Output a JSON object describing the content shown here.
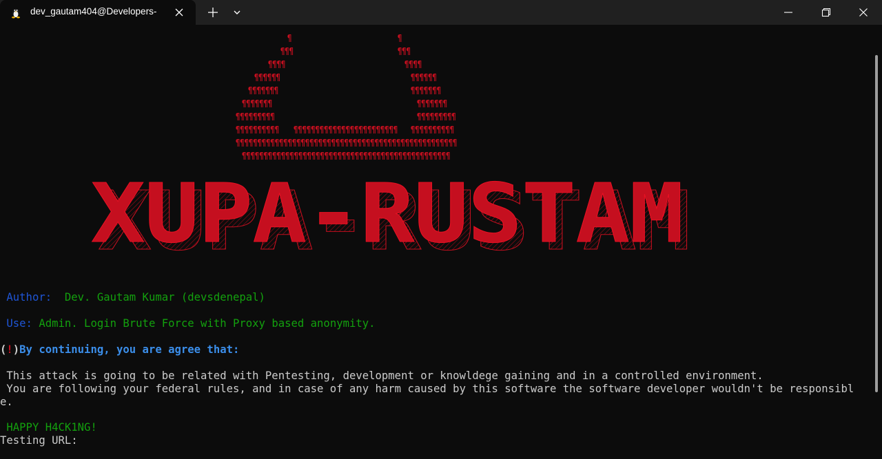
{
  "window": {
    "tab_title": "dev_gautam404@Developers-",
    "icons": {
      "tab": "linux-tux-icon",
      "close_tab": "close-icon",
      "new_tab": "plus-icon",
      "dropdown": "chevron-down-icon",
      "minimize": "minimize-icon",
      "maximize": "restore-icon",
      "close_window": "close-icon"
    }
  },
  "banner": {
    "glyph": "¶",
    "logo_text": "XUPA-RUSTAM",
    "color": "#c50f1f"
  },
  "terminal": {
    "author_label": "Author:",
    "author_value": "Dev. Gautam Kumar (devsdenepal)",
    "use_label": "Use:",
    "use_value": "Admin. Login Brute Force with Proxy based anonymity.",
    "warn_open": "(",
    "warn_mark": "!",
    "warn_close": ")",
    "warn_text": "By continuing, you are agree that:",
    "terms_line1": " This attack is going to be related with Pentesting, development or knowldege gaining and in a controlled environment.",
    "terms_line2": " You are following your federal rules, and in case of any harm caused by this software the software developer wouldn't be responsibl",
    "terms_line3": "e.",
    "happy": " HAPPY H4CK1NG!",
    "prompt": "Testing URL:"
  },
  "colors": {
    "background": "#0c0c0c",
    "label_blue": "#1f55d6",
    "text_green": "#13a10e",
    "banner_red": "#c50f1f",
    "text_white": "#cccccc"
  }
}
